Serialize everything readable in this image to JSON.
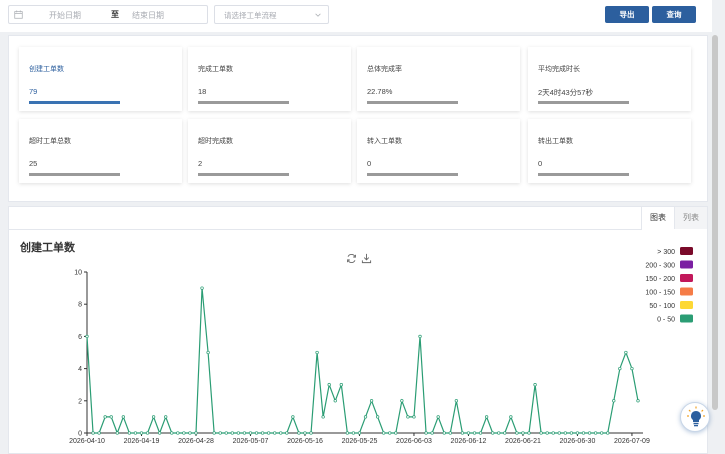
{
  "filters": {
    "date_start_placeholder": "开始日期",
    "date_separator": "至",
    "date_end_placeholder": "结束日期",
    "flow_placeholder": "请选择工单流程",
    "export_label": "导出",
    "query_label": "查询"
  },
  "stats": [
    {
      "label": "创建工单数",
      "value": "79"
    },
    {
      "label": "完成工单数",
      "value": "18"
    },
    {
      "label": "总体完成率",
      "value": "22.78%"
    },
    {
      "label": "平均完成时长",
      "value": "2天4时43分57秒"
    },
    {
      "label": "超时工单总数",
      "value": "25"
    },
    {
      "label": "超时完成数",
      "value": "2"
    },
    {
      "label": "转入工单数",
      "value": "0"
    },
    {
      "label": "转出工单数",
      "value": "0"
    }
  ],
  "tabs": {
    "chart": "图表",
    "list": "列表"
  },
  "icons": [
    "calendar-icon",
    "chevron-down-icon",
    "refresh-icon",
    "download-icon",
    "lightbulb-icon"
  ],
  "colors": {
    "primary": "#2c5f9e",
    "line": "#2b9d74"
  },
  "chart_data": {
    "type": "line",
    "title": "创建工单数",
    "x_start": "2026-04-10",
    "x_end": "2026-07-10",
    "ylim": [
      0,
      10
    ],
    "yticks": [
      0,
      2,
      4,
      6,
      8,
      10
    ],
    "xticks": [
      "2026-04-10",
      "2026-04-19",
      "2026-04-28",
      "2026-05-07",
      "2026-05-16",
      "2026-05-25",
      "2026-06-03",
      "2026-06-12",
      "2026-06-21",
      "2026-06-30",
      "2026-07-09"
    ],
    "grid": false,
    "legend_position": "top-right",
    "legend": [
      {
        "label": "> 300",
        "color": "#7a0a2a"
      },
      {
        "label": "200 - 300",
        "color": "#7b1fa2"
      },
      {
        "label": "150 - 200",
        "color": "#c2185b"
      },
      {
        "label": "100 - 150",
        "color": "#f57c47"
      },
      {
        "label": "50 - 100",
        "color": "#fdd835"
      },
      {
        "label": "0 - 50",
        "color": "#2b9d74"
      }
    ],
    "series": [
      {
        "values": [
          6,
          0,
          0,
          1,
          1,
          0,
          1,
          0,
          0,
          0,
          0,
          1,
          0,
          1,
          0,
          0,
          0,
          0,
          0,
          9,
          5,
          0,
          0,
          0,
          0,
          0,
          0,
          0,
          0,
          0,
          0,
          0,
          0,
          0,
          1,
          0,
          0,
          0,
          5,
          1,
          3,
          2,
          3,
          0,
          0,
          0,
          1,
          2,
          1,
          0,
          0,
          0,
          2,
          1,
          1,
          6,
          0,
          0,
          1,
          0,
          0,
          2,
          0,
          0,
          0,
          0,
          1,
          0,
          0,
          0,
          1,
          0,
          0,
          0,
          3,
          0,
          0,
          0,
          0,
          0,
          0,
          0,
          0,
          0,
          0,
          0,
          0,
          2,
          4,
          5,
          4,
          2
        ]
      }
    ]
  }
}
